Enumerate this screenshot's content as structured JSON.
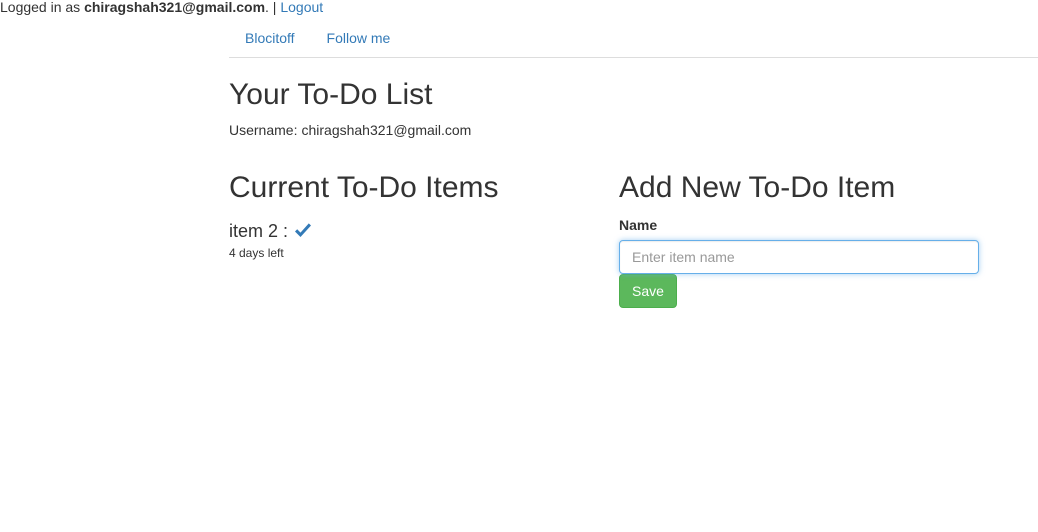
{
  "session": {
    "prefix": "Logged in as ",
    "email": "chiragshah321@gmail.com",
    "suffix": ". | ",
    "logout_label": "Logout"
  },
  "nav": {
    "items": [
      {
        "label": "Blocitoff"
      },
      {
        "label": "Follow me"
      }
    ]
  },
  "page": {
    "title": "Your To-Do List",
    "username_label": "Username:",
    "username_value": "chiragshah321@gmail.com"
  },
  "current_items": {
    "heading": "Current To-Do Items",
    "items": [
      {
        "name": "item 2 :",
        "icon": "checkmark-icon",
        "days_left": "4 days left"
      }
    ]
  },
  "new_item_form": {
    "heading": "Add New To-Do Item",
    "name_label": "Name",
    "name_value": "",
    "name_placeholder": "Enter item name",
    "save_label": "Save"
  },
  "colors": {
    "link": "#337ab7",
    "save_button": "#5cb85c",
    "input_focus_border": "#66afe9"
  }
}
